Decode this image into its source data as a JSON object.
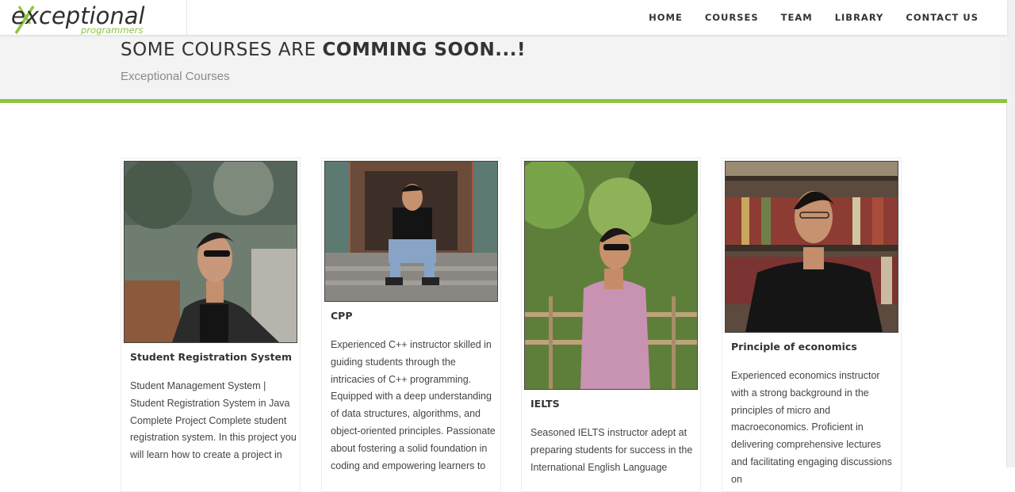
{
  "brand": {
    "logo_main": "exceptional",
    "logo_sub": "programmers",
    "accent": "#8cc63f"
  },
  "nav": {
    "items": [
      {
        "label": "HOME"
      },
      {
        "label": "COURSES"
      },
      {
        "label": "TEAM"
      },
      {
        "label": "LIBRARY"
      },
      {
        "label": "CONTACT US"
      }
    ]
  },
  "header": {
    "title_light": "SOME COURSES ARE ",
    "title_bold": "COMMING SOON...!",
    "subtitle": "Exceptional Courses"
  },
  "courses": [
    {
      "title": "Student Registration System",
      "description": "Student Management System | Student Registration System in Java Complete Project Complete student registration system. In this project you will learn how to create a project in"
    },
    {
      "title": "CPP",
      "description": "Experienced C++ instructor skilled in guiding students through the intricacies of C++ programming. Equipped with a deep understanding of data structures, algorithms, and object-oriented principles. Passionate about fostering a solid foundation in coding and empowering learners to"
    },
    {
      "title": "IELTS",
      "description": "Seasoned IELTS instructor adept at preparing students for success in the International English Language"
    },
    {
      "title": "Principle of economics",
      "description": "Experienced economics instructor with a strong background in the principles of micro and macroeconomics. Proficient in delivering comprehensive lectures and facilitating engaging discussions on"
    }
  ]
}
